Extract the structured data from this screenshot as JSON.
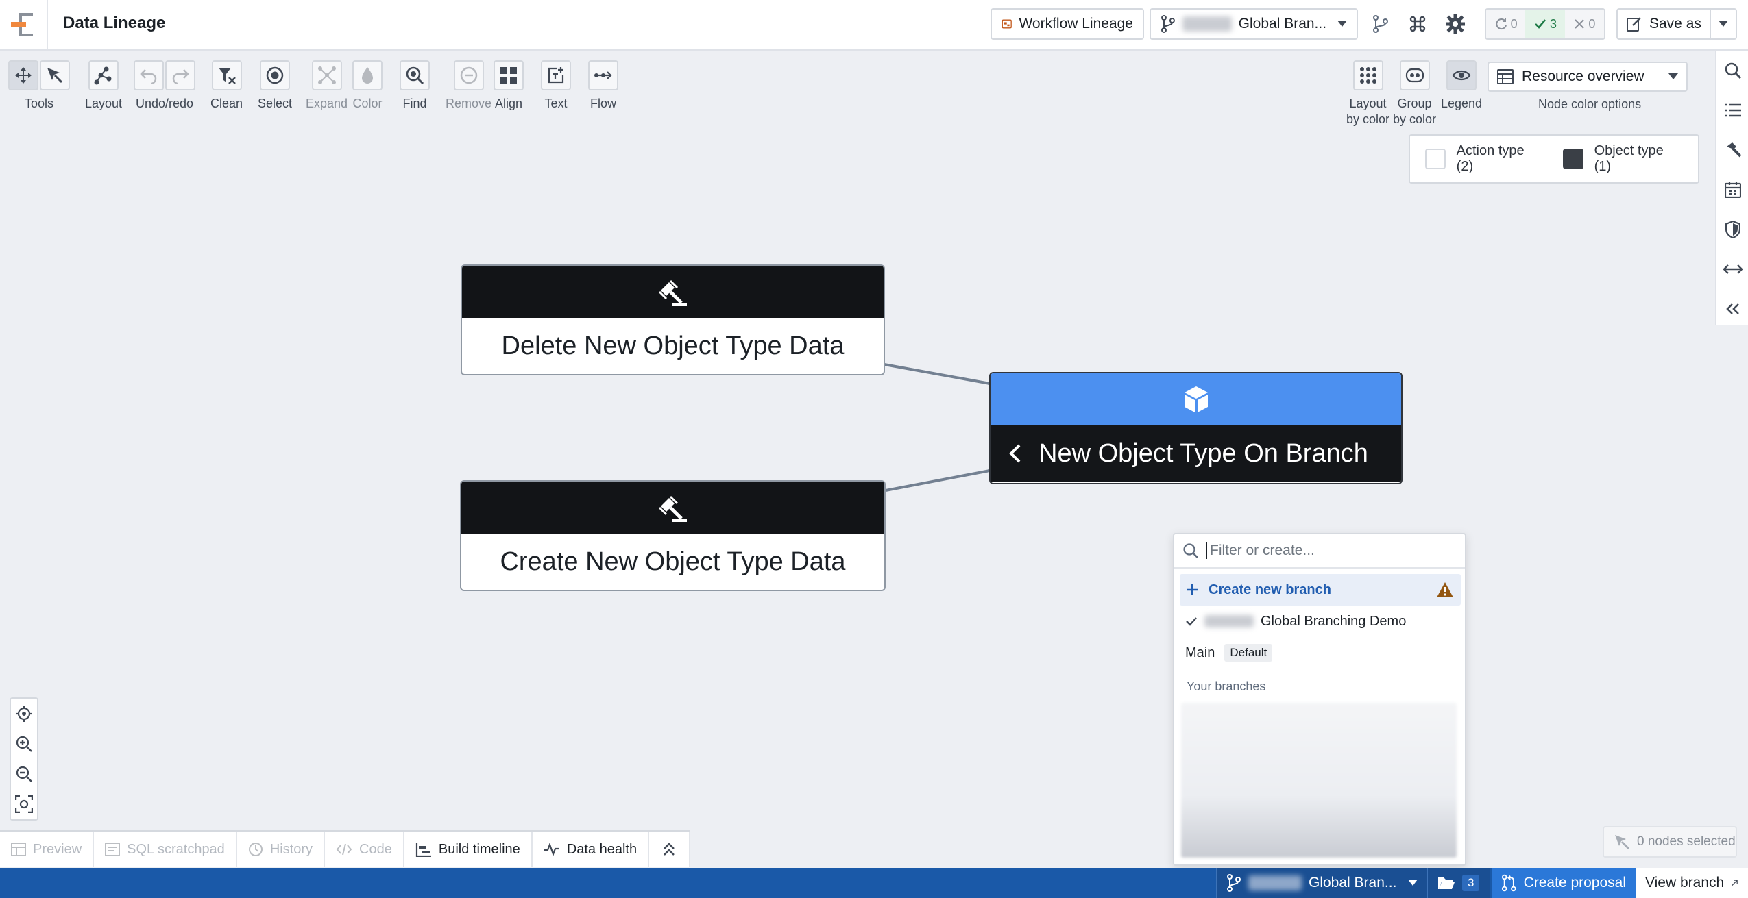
{
  "header": {
    "title": "Data Lineage",
    "workflow_lineage_label": "Workflow Lineage",
    "branch_label": "Global Bran...",
    "status": {
      "syncing": "0",
      "success": "3",
      "failed": "0"
    },
    "save_as_label": "Save as"
  },
  "toolbar": {
    "tools": "Tools",
    "layout": "Layout",
    "undo_redo": "Undo/redo",
    "clean": "Clean",
    "select": "Select",
    "expand": "Expand",
    "color": "Color",
    "find": "Find",
    "remove": "Remove",
    "align": "Align",
    "text": "Text",
    "flow": "Flow",
    "layout_by_color_1": "Layout",
    "layout_by_color_2": "by color",
    "group_by_color_1": "Group",
    "group_by_color_2": "by color",
    "legend": "Legend",
    "node_color_value": "Resource overview",
    "node_color_options": "Node color options"
  },
  "legend": {
    "action_type": "Action type (2)",
    "object_type": "Object type (1)",
    "action_color": "#ffffff",
    "object_color": "#3a3f46"
  },
  "graph": {
    "node_delete": "Delete New Object Type Data",
    "node_create": "Create New Object Type Data",
    "node_object": "New Object Type On Branch",
    "edge_color": "#738091",
    "object_header_color": "#4c90f0"
  },
  "branch_dropdown": {
    "filter_placeholder": "Filter or create...",
    "create_label": "Create new branch",
    "selected_branch": "Global Branching Demo",
    "main_label": "Main",
    "default_badge": "Default",
    "your_branches": "Your branches"
  },
  "bottom_tabs": {
    "preview": "Preview",
    "sql": "SQL scratchpad",
    "history": "History",
    "code": "Code",
    "build_timeline": "Build timeline",
    "data_health": "Data health"
  },
  "nodes_selected": "0 nodes selected",
  "statusbar": {
    "branch": "Global Bran...",
    "count": "3",
    "create_proposal": "Create proposal",
    "view_branch": "View branch",
    "bar_color": "#1a59a8"
  }
}
